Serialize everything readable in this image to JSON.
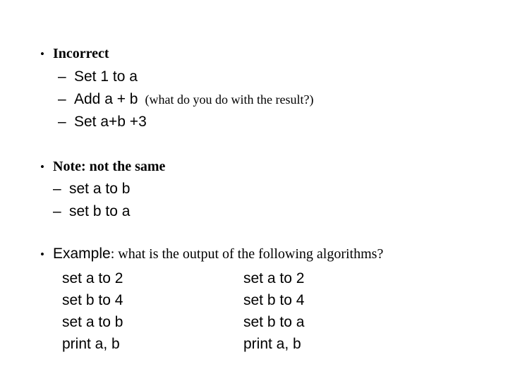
{
  "slide": {
    "background_color": "#ffffff",
    "text_color": "#000000",
    "bullet_glyph": "•",
    "dash_glyph": "–",
    "sections": [
      {
        "id": "incorrect",
        "title": "Incorrect",
        "items": [
          {
            "main": "Set 1 to a",
            "note": ""
          },
          {
            "main": "Add a + b",
            "note": "(what do you do with the result?)"
          },
          {
            "main": "Set a+b +3",
            "note": ""
          }
        ]
      },
      {
        "id": "note",
        "title": "Note: not the same",
        "items": [
          {
            "main": "set a to b",
            "note": ""
          },
          {
            "main": "set b to a",
            "note": ""
          }
        ]
      },
      {
        "id": "example",
        "title": "Example",
        "title_tail": ": what is the output of the following algorithms?",
        "columns": [
          {
            "id": "left",
            "lines": [
              "set a to 2",
              "set b to 4",
              "set a to b",
              "print a, b"
            ]
          },
          {
            "id": "right",
            "lines": [
              "set a to 2",
              "set b to 4",
              "set b to a",
              "print a, b"
            ]
          }
        ]
      }
    ]
  }
}
